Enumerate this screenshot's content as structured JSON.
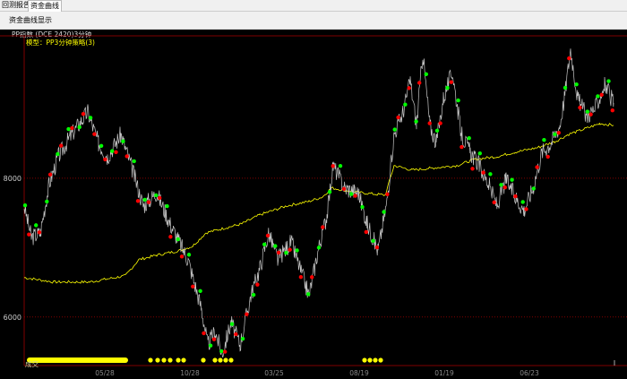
{
  "tabs": [
    {
      "label": "回测报告",
      "active": false
    },
    {
      "label": "资金曲线",
      "active": true
    }
  ],
  "toolbar": {
    "show_label": "资金曲线显示"
  },
  "chart_header": {
    "symbol": "PP指数  (DCE 2420)3分钟",
    "model": "模型：PP3分钟策略(3)",
    "volume_label": "成交"
  },
  "colors": {
    "price": "#c8c8c8",
    "equity": "#ffff00",
    "buy": "#00ff00",
    "sell": "#ff0000",
    "grid": "#800000"
  },
  "chart_data": {
    "type": "line",
    "yticks": [
      6000,
      8000
    ],
    "ylim": [
      5300,
      10050
    ],
    "xlim": [
      0,
      673
    ],
    "xticks": [
      {
        "x": 90,
        "label": "05/28"
      },
      {
        "x": 185,
        "label": "10/28"
      },
      {
        "x": 279,
        "label": "03/25"
      },
      {
        "x": 374,
        "label": "08/19"
      },
      {
        "x": 469,
        "label": "01/19"
      },
      {
        "x": 564,
        "label": "06/23"
      }
    ],
    "series": [
      {
        "name": "price",
        "x": [
          0,
          8,
          18,
          28,
          38,
          53,
          71,
          83,
          93,
          108,
          121,
          133,
          148,
          163,
          183,
          198,
          205,
          213,
          221,
          231,
          241,
          253,
          263,
          273,
          283,
          298,
          318,
          328,
          338,
          345,
          358,
          373,
          383,
          395,
          405,
          413,
          423,
          431,
          438,
          445,
          453,
          460,
          468,
          478,
          488,
          498,
          508,
          518,
          528,
          538,
          548,
          558,
          568,
          578,
          588,
          598,
          603,
          610,
          618,
          628,
          638,
          648,
          658
        ],
        "y": [
          7600,
          7148,
          7213,
          7923,
          8310,
          8632,
          8955,
          8503,
          8310,
          8632,
          8116,
          7600,
          7794,
          7342,
          6826,
          6116,
          5600,
          5794,
          5471,
          5923,
          5600,
          6310,
          6697,
          7213,
          6826,
          7084,
          6310,
          6955,
          7471,
          8181,
          7858,
          7794,
          7342,
          6955,
          7665,
          8632,
          8955,
          9406,
          8761,
          9794,
          8761,
          8503,
          9148,
          9535,
          8632,
          8374,
          8181,
          7923,
          7600,
          7987,
          7729,
          7535,
          7858,
          8374,
          8503,
          8761,
          9148,
          9858,
          9148,
          8890,
          9019,
          9342,
          9084
        ]
      },
      {
        "name": "equity",
        "x": [
          0,
          33,
          73,
          113,
          128,
          148,
          173,
          188,
          203,
          223,
          243,
          263,
          293,
          318,
          333,
          343,
          373,
          403,
          413,
          433,
          453,
          483,
          503,
          528,
          548,
          573,
          593,
          608,
          623,
          643,
          658
        ],
        "y": [
          6568,
          6503,
          6503,
          6594,
          6826,
          6890,
          6955,
          7019,
          7213,
          7277,
          7342,
          7471,
          7600,
          7665,
          7729,
          7858,
          7794,
          7755,
          8181,
          8116,
          8142,
          8181,
          8271,
          8310,
          8374,
          8439,
          8529,
          8632,
          8697,
          8787,
          8761
        ]
      }
    ],
    "signal_bars": [
      [
        3,
        116
      ]
    ],
    "signal_points": [
      141,
      149,
      156,
      163,
      172,
      178,
      200,
      213,
      219,
      225,
      231,
      380,
      386,
      392,
      398
    ]
  }
}
